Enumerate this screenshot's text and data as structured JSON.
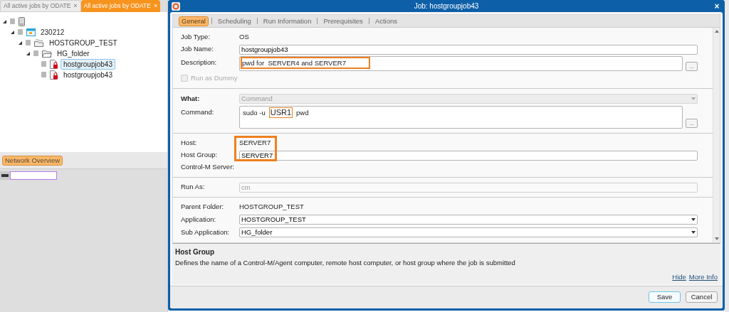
{
  "left_tabs": [
    {
      "label": "All active jobs by ODATE",
      "selected": false,
      "close": "×"
    },
    {
      "label": "All active jobs by ODATE",
      "selected": true,
      "close": "×"
    }
  ],
  "tree": [
    {
      "kind": "server",
      "expanded": true,
      "selected": false,
      "children": [
        {
          "kind": "calendar",
          "label": "230212",
          "expanded": true,
          "selected": false,
          "children": [
            {
              "kind": "group",
              "label": "HOSTGROUP_TEST",
              "expanded": true,
              "selected": false,
              "children": [
                {
                  "kind": "folder",
                  "label": "HG_folder",
                  "expanded": true,
                  "selected": false,
                  "children": [
                    {
                      "kind": "job",
                      "label": "hostgroupjob43",
                      "expanded": false,
                      "selected": true
                    },
                    {
                      "kind": "job",
                      "label": "hostgroupjob43",
                      "expanded": false,
                      "selected": false
                    }
                  ]
                }
              ]
            }
          ]
        }
      ]
    }
  ],
  "network_overview": {
    "tab": "Network Overview"
  },
  "dialog": {
    "title": "Job: hostgroupjob43",
    "close": "×",
    "tabs": [
      {
        "label": "General",
        "selected": true
      },
      {
        "label": "Scheduling",
        "selected": false
      },
      {
        "label": "Run Information",
        "selected": false
      },
      {
        "label": "Prerequisites",
        "selected": false
      },
      {
        "label": "Actions",
        "selected": false
      }
    ],
    "sections": [
      {
        "rows": [
          {
            "kind": "static",
            "label": "Job Type:",
            "value": "OS"
          },
          {
            "kind": "text",
            "label": "Job Name:",
            "value": "hostgroupjob43",
            "disabled": false
          },
          {
            "kind": "textarea",
            "label": "Description:",
            "value": "pwd for  SERVER4 and SERVER7",
            "highlighted": true,
            "button": "..."
          },
          {
            "kind": "checkbox",
            "label": "Run as Dummy",
            "checked": false,
            "disabled": true
          }
        ]
      },
      {
        "rows": [
          {
            "kind": "select",
            "label": "What:",
            "value": "Command",
            "disabled": true,
            "bold": true
          },
          {
            "kind": "command",
            "label": "Command:",
            "segments": [
              {
                "text": "sudo -u",
                "highlighted": false
              },
              {
                "text": "USR1",
                "highlighted": true
              },
              {
                "text": "pwd",
                "highlighted": false
              }
            ],
            "button": "..."
          }
        ]
      },
      {
        "highlight_box": true,
        "rows": [
          {
            "kind": "static",
            "label": "Host:",
            "value": "SERVER7"
          },
          {
            "kind": "text",
            "label": "Host Group:",
            "value": "SERVER7",
            "disabled": false
          },
          {
            "kind": "static",
            "label": "Control-M Server:"
          }
        ]
      },
      {
        "rows": [
          {
            "kind": "text",
            "label": "Run As:",
            "value": "cm",
            "disabled": true
          }
        ]
      },
      {
        "rows": [
          {
            "kind": "static",
            "label": "Parent Folder:",
            "value": "HOSTGROUP_TEST"
          },
          {
            "kind": "select",
            "label": "Application:",
            "value": "HOSTGROUP_TEST",
            "disabled": false,
            "bold": false
          },
          {
            "kind": "select",
            "label": "Sub Application:",
            "value": "HG_folder",
            "disabled": false,
            "bold": false
          }
        ]
      }
    ],
    "help": {
      "title": "Host Group",
      "text": "Defines the name of a Control-M/Agent computer, remote host computer, or host group where the job is submitted",
      "links": [
        "Hide",
        "More Info"
      ]
    },
    "buttons": [
      {
        "label": "Save",
        "default": true
      },
      {
        "label": "Cancel",
        "default": false
      }
    ]
  }
}
